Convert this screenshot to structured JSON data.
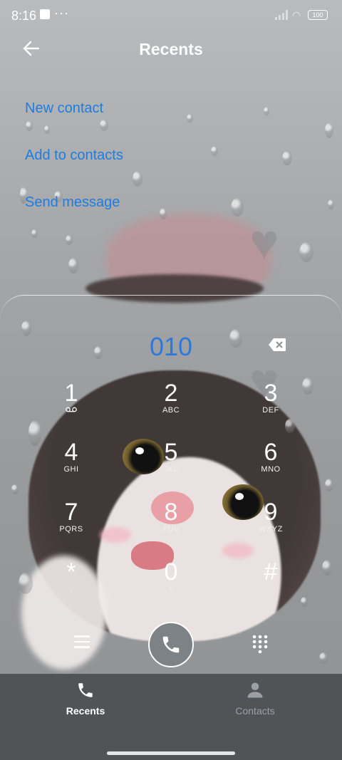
{
  "status_bar": {
    "time": "8:16",
    "notif_dots": "···",
    "battery": "100"
  },
  "header": {
    "title": "Recents"
  },
  "actions": [
    {
      "label": "New contact"
    },
    {
      "label": "Add to contacts"
    },
    {
      "label": "Send message"
    }
  ],
  "dialer": {
    "number": "010",
    "keys": [
      {
        "digit": "1",
        "sub": "voicemail-icon"
      },
      {
        "digit": "2",
        "sub": "ABC"
      },
      {
        "digit": "3",
        "sub": "DEF"
      },
      {
        "digit": "4",
        "sub": "GHI"
      },
      {
        "digit": "5",
        "sub": "JKL"
      },
      {
        "digit": "6",
        "sub": "MNO"
      },
      {
        "digit": "7",
        "sub": "PQRS"
      },
      {
        "digit": "8",
        "sub": "TUV"
      },
      {
        "digit": "9",
        "sub": "WXYZ"
      },
      {
        "digit": "*",
        "sub": ","
      },
      {
        "digit": "0",
        "sub": "+"
      },
      {
        "digit": "#",
        "sub": ""
      }
    ]
  },
  "bottom_nav": [
    {
      "label": "Recents",
      "icon": "phone-icon",
      "active": true
    },
    {
      "label": "Contacts",
      "icon": "person-icon",
      "active": false
    }
  ],
  "colors": {
    "accent": "#1d7de0",
    "nav_bg": "#505457",
    "call_button": "#7d8287"
  }
}
